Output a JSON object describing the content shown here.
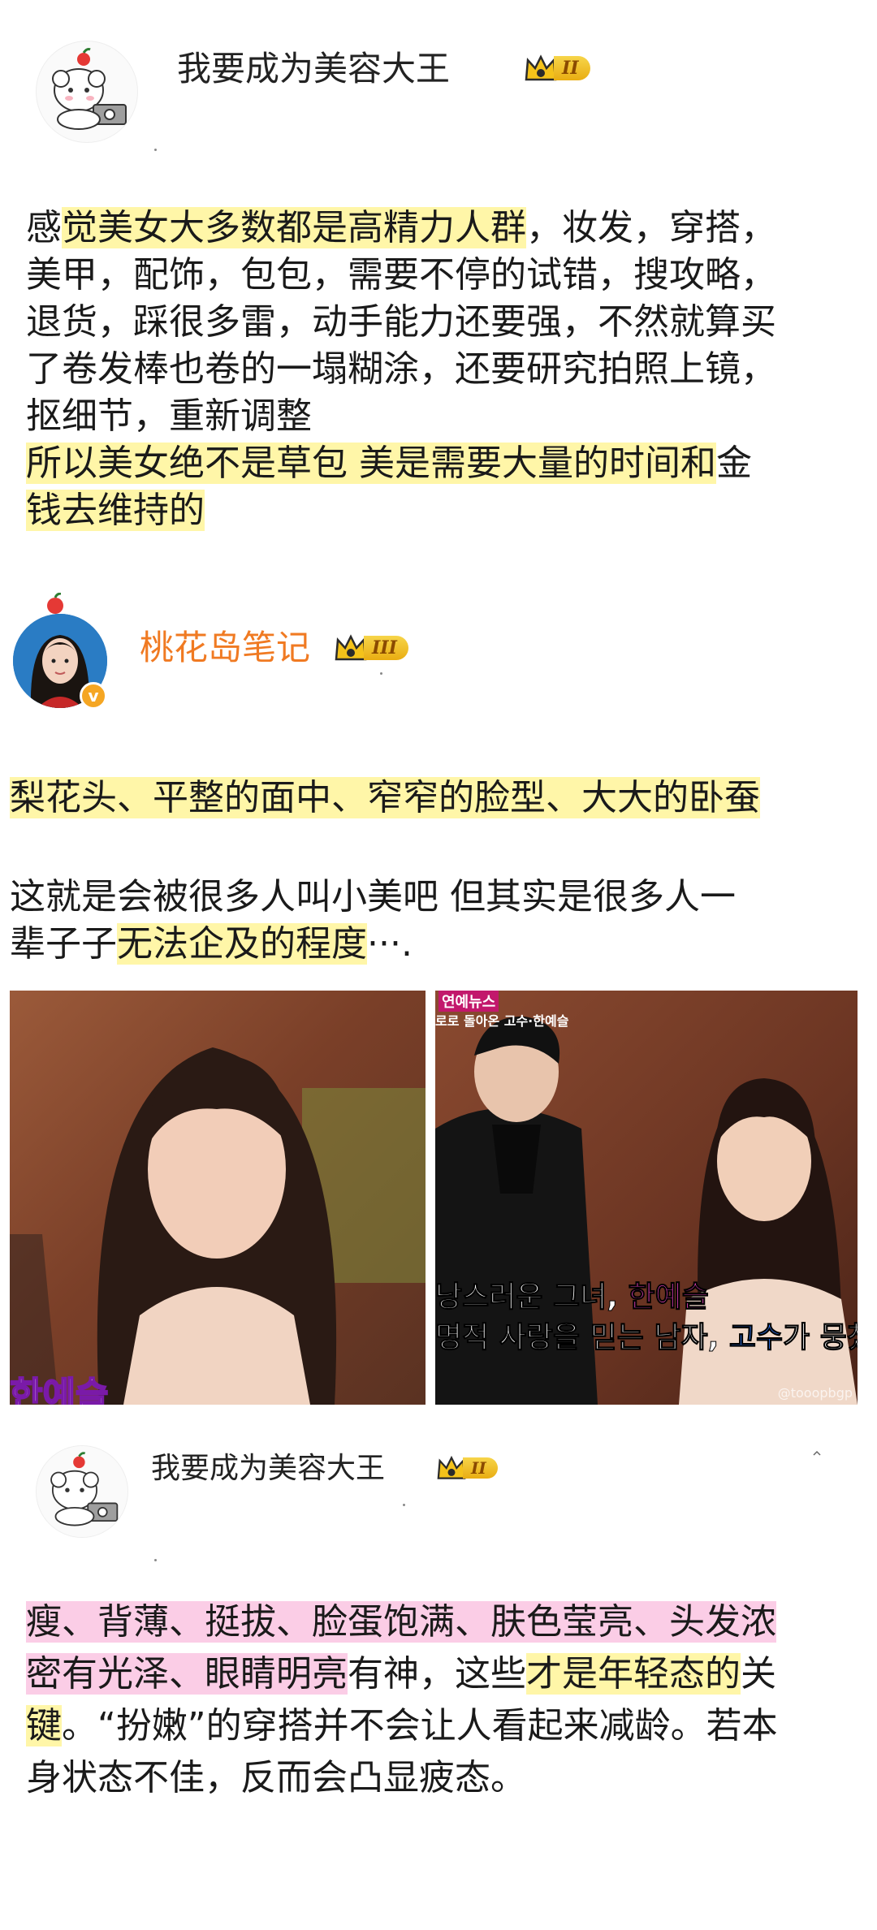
{
  "post1": {
    "username": "我要成为美容大王",
    "level": "II",
    "text_lines": [
      {
        "segments": [
          {
            "t": "感",
            "h": ""
          },
          {
            "t": "觉美女大多数都是高精力人群",
            "h": "y"
          },
          {
            "t": "，妆发，穿搭，",
            "h": ""
          }
        ]
      },
      {
        "segments": [
          {
            "t": "美甲，配饰，包包，需要不停的试错，搜攻略，",
            "h": ""
          }
        ]
      },
      {
        "segments": [
          {
            "t": "退货，踩很多雷，动手能力还要强，不然就算买",
            "h": ""
          }
        ]
      },
      {
        "segments": [
          {
            "t": "了卷发棒也卷的一塌糊涂，还要研究拍照上镜，",
            "h": ""
          }
        ]
      },
      {
        "segments": [
          {
            "t": "抠细节，重新调整",
            "h": ""
          }
        ]
      },
      {
        "segments": [
          {
            "t": "所以美女绝不是草包 美是需要大量的时间和",
            "h": "y"
          },
          {
            "t": "金",
            "h": ""
          }
        ]
      },
      {
        "segments": [
          {
            "t": "钱去维持的",
            "h": "y"
          }
        ]
      }
    ]
  },
  "post2": {
    "username": "桃花岛笔记",
    "level": "III",
    "line1": "梨花头、平整的面中、窄窄的脸型、大大的卧蚕",
    "line2": "这就是会被很多人叫小美吧 但其实是很多人一",
    "line3_a": "辈子子",
    "line3_b": "无法企及的程度",
    "line3_c": "···.",
    "photo_left_caption": "한예슬",
    "photo_right_top": "연예뉴스",
    "photo_right_sub": "로로 돌아온 고수·한예슬",
    "photo_right_line1_a": "낭스러운 그녀, ",
    "photo_right_line1_b": "한예슬",
    "photo_right_line2_a": "명적 사랑을 믿는 남자, ",
    "photo_right_line2_b": "고수",
    "photo_right_line2_c": "가 뭉쳤",
    "photo_right_watermark": "@tooopbgp"
  },
  "post3": {
    "username": "我要成为美容大王",
    "level": "II",
    "collapse_icon": "chevron-up-icon",
    "text_lines": [
      {
        "segments": [
          {
            "t": "瘦、背薄、挺拔、脸蛋饱满、肤色莹亮、头发浓",
            "h": "p"
          }
        ]
      },
      {
        "segments": [
          {
            "t": "密有光泽、眼睛明亮",
            "h": "p"
          },
          {
            "t": "有神，这些",
            "h": ""
          },
          {
            "t": "才是年轻态的",
            "h": "y"
          },
          {
            "t": "关",
            "h": ""
          }
        ]
      },
      {
        "segments": [
          {
            "t": "键",
            "h": "y"
          },
          {
            "t": "。“扮嫩”的穿搭并不会让人看起来减龄。若本",
            "h": ""
          }
        ]
      },
      {
        "segments": [
          {
            "t": "身状态不佳，反而会凸显疲态。",
            "h": ""
          }
        ]
      }
    ]
  },
  "colors": {
    "accent_name": "#f07a22",
    "highlight_yellow": "#fff6a8",
    "highlight_pink": "#fbcde6"
  }
}
